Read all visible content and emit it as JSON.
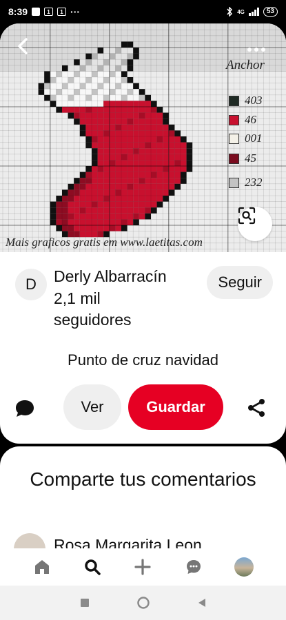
{
  "status_bar": {
    "time": "8:39",
    "battery": "53",
    "network": "4G",
    "more": "···"
  },
  "image": {
    "legend_title": "Anchor",
    "legend": [
      {
        "code": "403",
        "color": "#1f2a24"
      },
      {
        "code": "46",
        "color": "#c8102e"
      },
      {
        "code": "001",
        "color": "#f4f1e8"
      },
      {
        "code": "45",
        "color": "#7a0b1e"
      },
      {
        "code": "232",
        "color": "#c3c3c3"
      }
    ],
    "watermark": "Mais graficos gratis em www.laetitas.com"
  },
  "author": {
    "initial": "D",
    "name": "Derly Albarracín",
    "followers": "2,1 mil seguidores",
    "follow_label": "Seguir"
  },
  "pin": {
    "title": "Punto de cruz navidad"
  },
  "actions": {
    "view_label": "Ver",
    "save_label": "Guardar"
  },
  "comments": {
    "title": "Comparte tus comentarios",
    "first_author": "Rosa Margarita Leon"
  },
  "colors": {
    "brand_red": "#e60023",
    "chip_gray": "#efefef"
  },
  "icons": {
    "back": "chevron-left-icon",
    "more": "more-horizontal-icon",
    "lens": "visual-search-icon",
    "comment": "comment-icon",
    "share": "share-icon",
    "nav": [
      "home-icon",
      "search-icon",
      "plus-icon",
      "messages-icon",
      "profile-icon"
    ]
  }
}
